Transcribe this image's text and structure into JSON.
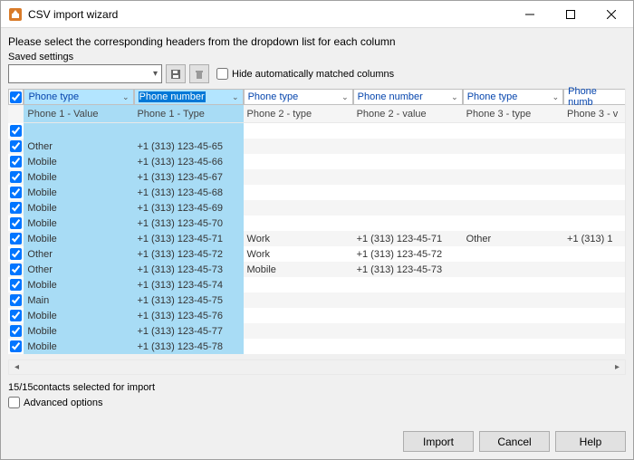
{
  "window": {
    "title": "CSV import wizard"
  },
  "instruction": "Please select the corresponding headers from the dropdown list for each column",
  "saved_settings": {
    "label": "Saved settings",
    "hide_label": "Hide automatically matched columns"
  },
  "columns": {
    "mapped": [
      "Phone type",
      "Phone number",
      "Phone type",
      "Phone number",
      "Phone type",
      "Phone numb"
    ],
    "source": [
      "Phone 1 - Value",
      "Phone 1 - Type",
      "Phone 2 - type",
      "Phone 2 - value",
      "Phone 3 - type",
      "Phone 3 - v"
    ]
  },
  "rows": [
    {
      "c": [
        "",
        "",
        "",
        "",
        "",
        ""
      ]
    },
    {
      "c": [
        "Other",
        "+1 (313) 123-45-65",
        "",
        "",
        "",
        ""
      ]
    },
    {
      "c": [
        "Mobile",
        "+1 (313) 123-45-66",
        "",
        "",
        "",
        ""
      ]
    },
    {
      "c": [
        "Mobile",
        "+1 (313) 123-45-67",
        "",
        "",
        "",
        ""
      ]
    },
    {
      "c": [
        "Mobile",
        "+1 (313) 123-45-68",
        "",
        "",
        "",
        ""
      ]
    },
    {
      "c": [
        "Mobile",
        "+1 (313) 123-45-69",
        "",
        "",
        "",
        ""
      ]
    },
    {
      "c": [
        "Mobile",
        "+1 (313) 123-45-70",
        "",
        "",
        "",
        ""
      ]
    },
    {
      "c": [
        "Mobile",
        "+1 (313) 123-45-71",
        "Work",
        "+1 (313) 123-45-71",
        "Other",
        "+1 (313) 1"
      ]
    },
    {
      "c": [
        "Other",
        "+1 (313) 123-45-72",
        "Work",
        "+1 (313) 123-45-72",
        "",
        ""
      ]
    },
    {
      "c": [
        "Other",
        "+1 (313) 123-45-73",
        "Mobile",
        "+1 (313) 123-45-73",
        "",
        ""
      ]
    },
    {
      "c": [
        "Mobile",
        "+1 (313) 123-45-74",
        "",
        "",
        "",
        ""
      ]
    },
    {
      "c": [
        "Main",
        "+1 (313) 123-45-75",
        "",
        "",
        "",
        ""
      ]
    },
    {
      "c": [
        "Mobile",
        "+1 (313) 123-45-76",
        "",
        "",
        "",
        ""
      ]
    },
    {
      "c": [
        "Mobile",
        "+1 (313) 123-45-77",
        "",
        "",
        "",
        ""
      ]
    },
    {
      "c": [
        "Mobile",
        "+1 (313) 123-45-78",
        "",
        "",
        "",
        ""
      ]
    }
  ],
  "status": "15/15contacts selected for import",
  "advanced": "Advanced options",
  "buttons": {
    "import": "Import",
    "cancel": "Cancel",
    "help": "Help"
  }
}
